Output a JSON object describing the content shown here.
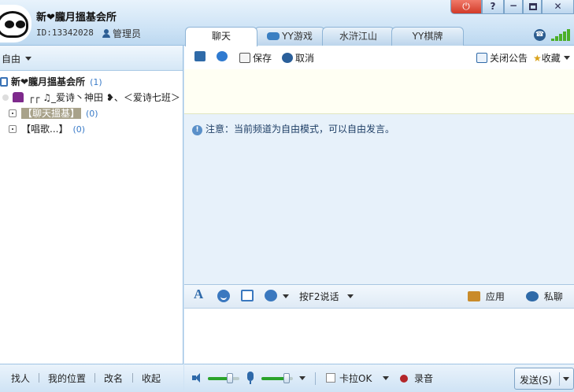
{
  "header": {
    "channel_name": "新❤朧月搵基会所",
    "channel_id": "ID:13342028",
    "role": "管理员",
    "window_buttons": {
      "power": "⏻",
      "help": "?",
      "minimize": "−",
      "close": "✕"
    }
  },
  "tabs": [
    {
      "label": "聊天",
      "active": true
    },
    {
      "label": "YY游戏",
      "active": false
    },
    {
      "label": "水浒江山",
      "active": false
    },
    {
      "label": "YY棋牌",
      "active": false
    }
  ],
  "left": {
    "mode": "自由",
    "tree": {
      "root": {
        "label": "新❤朧月搵基会所",
        "count": "(1)"
      },
      "user": {
        "label": "┌┌ ♫_爱诗丶神田 ❥、＜爱诗七班＞"
      },
      "subchannels": [
        {
          "label": "【聊天搵基】",
          "count": "(0)",
          "highlighted": true
        },
        {
          "label": "【唱歌...】",
          "count": "(0)",
          "highlighted": false
        }
      ]
    },
    "footer": [
      "找人",
      "我的位置",
      "改名",
      "收起"
    ]
  },
  "right": {
    "toolbar": {
      "save": "保存",
      "cancel": "取消",
      "close_announcement": "关闭公告",
      "favorite": "收藏"
    },
    "notice": "注意：当前频道为自由模式，可以自由发言。",
    "input_toolbar": {
      "speak_mode": "按F2说话",
      "apps": "应用",
      "private_chat": "私聊"
    },
    "footer": {
      "karaoke": "卡拉OK",
      "record": "录音",
      "send": "发送(S)",
      "speaker_volume": 0.7,
      "mic_volume": 0.8
    }
  },
  "colors": {
    "accent": "#3a78bf",
    "power": "#d23a28",
    "signal": "#4caf28",
    "record": "#b3262a"
  }
}
